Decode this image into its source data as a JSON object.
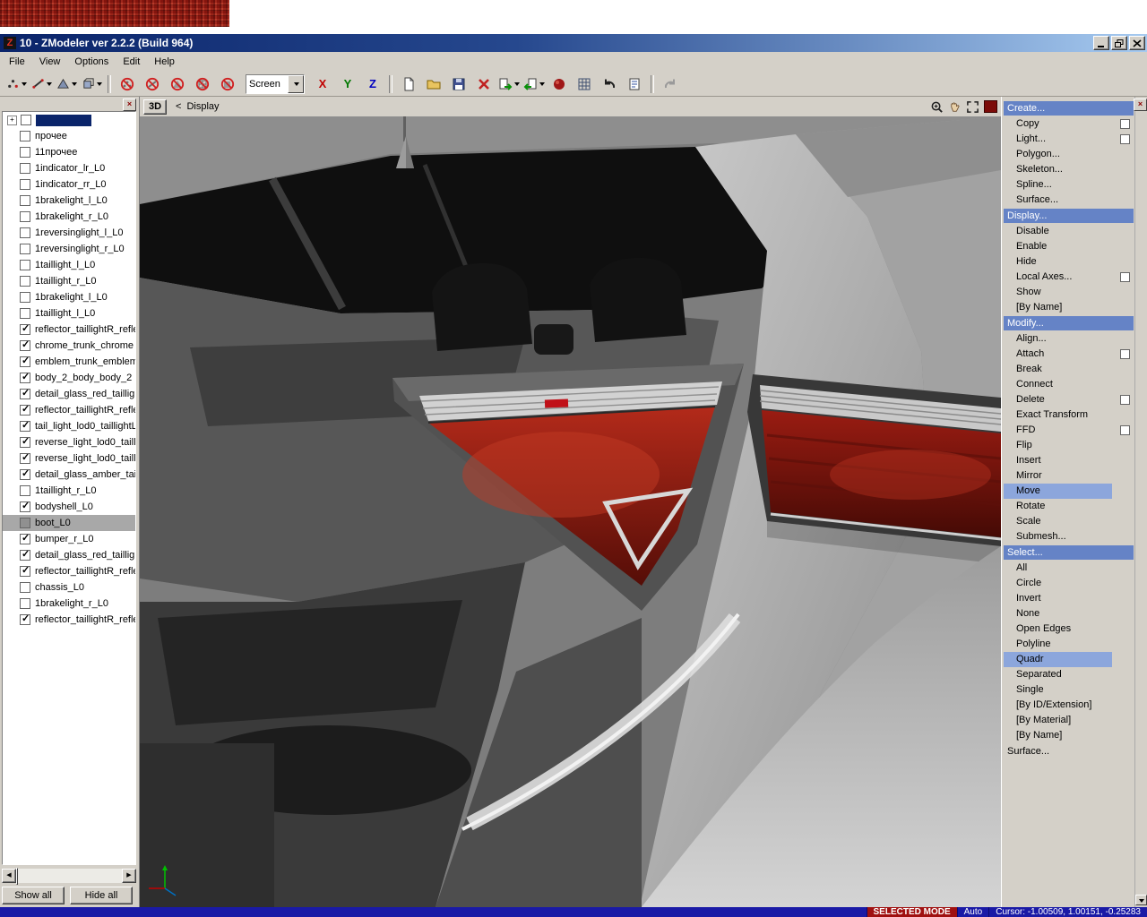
{
  "window": {
    "title": "10 - ZModeler ver 2.2.2 (Build 964)",
    "controls": [
      "minimize",
      "restore",
      "close"
    ]
  },
  "menu": {
    "items": [
      "File",
      "View",
      "Options",
      "Edit",
      "Help"
    ]
  },
  "toolbar": {
    "screen_value": "Screen",
    "axis": {
      "x": "X",
      "y": "Y",
      "z": "Z"
    },
    "mode_dropdowns": [
      "vertices-level",
      "edges-level",
      "polygons-level",
      "objects-level"
    ],
    "filter_toggles": [
      "no-vertices",
      "no-edges",
      "no-polygons",
      "no-meshes",
      "no-objects"
    ],
    "file_tools": [
      "new-file",
      "open-file",
      "save-file",
      "delete",
      "import",
      "export",
      "material-ball",
      "grid",
      "undo",
      "log",
      "redo-disabled"
    ]
  },
  "scene_tree": {
    "root": {
      "label": "",
      "expanded": false,
      "selected": true
    },
    "items": [
      {
        "label": "прочее",
        "checked": false
      },
      {
        "label": "11прочее",
        "checked": false
      },
      {
        "label": "1indicator_lr_L0",
        "checked": false
      },
      {
        "label": "1indicator_rr_L0",
        "checked": false
      },
      {
        "label": "1brakelight_l_L0",
        "checked": false
      },
      {
        "label": "1brakelight_r_L0",
        "checked": false
      },
      {
        "label": "1reversinglight_l_L0",
        "checked": false
      },
      {
        "label": "1reversinglight_r_L0",
        "checked": false
      },
      {
        "label": "1taillight_l_L0",
        "checked": false
      },
      {
        "label": "1taillight_r_L0",
        "checked": false
      },
      {
        "label": "1brakelight_l_L0",
        "checked": false
      },
      {
        "label": "1taillight_l_L0",
        "checked": false
      },
      {
        "label": "reflector_taillightR_refle",
        "checked": true
      },
      {
        "label": "chrome_trunk_chrome",
        "checked": true
      },
      {
        "label": "emblem_trunk_emblem",
        "checked": true
      },
      {
        "label": "body_2_body_body_2",
        "checked": true
      },
      {
        "label": "detail_glass_red_tailligh",
        "checked": true
      },
      {
        "label": "reflector_taillightR_refle",
        "checked": true
      },
      {
        "label": "tail_light_lod0_taillightL_",
        "checked": true
      },
      {
        "label": "reverse_light_lod0_tailli",
        "checked": true
      },
      {
        "label": "reverse_light_lod0_tailli",
        "checked": true
      },
      {
        "label": "detail_glass_amber_taill",
        "checked": true
      },
      {
        "label": "1taillight_r_L0",
        "checked": false
      },
      {
        "label": "bodyshell_L0",
        "checked": true
      },
      {
        "label": "boot_L0",
        "checked": false,
        "partial": true,
        "selected": true
      },
      {
        "label": "bumper_r_L0",
        "checked": true
      },
      {
        "label": "detail_glass_red_tailligh",
        "checked": true
      },
      {
        "label": "reflector_taillightR_refle",
        "checked": true
      },
      {
        "label": "chassis_L0",
        "checked": false
      },
      {
        "label": "1brakelight_r_L0",
        "checked": false
      },
      {
        "label": "reflector_taillightR_refle",
        "checked": true
      }
    ],
    "show_all_label": "Show all",
    "hide_all_label": "Hide all"
  },
  "viewport": {
    "tab": "3D",
    "nav_arrow": "<",
    "view_name": "Display"
  },
  "commands_panel": {
    "items": [
      {
        "label": "Create...",
        "kind": "header"
      },
      {
        "label": "Copy",
        "kind": "item",
        "checkbox": true
      },
      {
        "label": "Light...",
        "kind": "item",
        "checkbox": true
      },
      {
        "label": "Polygon...",
        "kind": "item"
      },
      {
        "label": "Skeleton...",
        "kind": "item"
      },
      {
        "label": "Spline...",
        "kind": "item"
      },
      {
        "label": "Surface...",
        "kind": "item"
      },
      {
        "label": "Display...",
        "kind": "header"
      },
      {
        "label": "Disable",
        "kind": "item"
      },
      {
        "label": "Enable",
        "kind": "item"
      },
      {
        "label": "Hide",
        "kind": "item"
      },
      {
        "label": "Local Axes...",
        "kind": "item",
        "checkbox": true
      },
      {
        "label": "Show",
        "kind": "item"
      },
      {
        "label": "[By Name]",
        "kind": "item"
      },
      {
        "label": "Modify...",
        "kind": "header"
      },
      {
        "label": "Align...",
        "kind": "item"
      },
      {
        "label": "Attach",
        "kind": "item",
        "checkbox": true
      },
      {
        "label": "Break",
        "kind": "item"
      },
      {
        "label": "Connect",
        "kind": "item"
      },
      {
        "label": "Delete",
        "kind": "item",
        "checkbox": true
      },
      {
        "label": "Exact Transform",
        "kind": "item"
      },
      {
        "label": "FFD",
        "kind": "item",
        "checkbox": true
      },
      {
        "label": "Flip",
        "kind": "item"
      },
      {
        "label": "Insert",
        "kind": "item"
      },
      {
        "label": "Mirror",
        "kind": "item"
      },
      {
        "label": "Move",
        "kind": "item",
        "selected": true
      },
      {
        "label": "Rotate",
        "kind": "item"
      },
      {
        "label": "Scale",
        "kind": "item"
      },
      {
        "label": "Submesh...",
        "kind": "item"
      },
      {
        "label": "Select...",
        "kind": "header"
      },
      {
        "label": "All",
        "kind": "item"
      },
      {
        "label": "Circle",
        "kind": "item"
      },
      {
        "label": "Invert",
        "kind": "item"
      },
      {
        "label": "None",
        "kind": "item"
      },
      {
        "label": "Open Edges",
        "kind": "item"
      },
      {
        "label": "Polyline",
        "kind": "item"
      },
      {
        "label": "Quadr",
        "kind": "item",
        "selected": true
      },
      {
        "label": "Separated",
        "kind": "item"
      },
      {
        "label": "Single",
        "kind": "item"
      },
      {
        "label": "[By ID/Extension]",
        "kind": "item"
      },
      {
        "label": "[By Material]",
        "kind": "item"
      },
      {
        "label": "[By Name]",
        "kind": "item"
      },
      {
        "label": "Surface...",
        "kind": "plain"
      }
    ]
  },
  "status_bar": {
    "selected_mode": "SELECTED MODE",
    "auto_label": "Auto",
    "cursor_text": "Cursor: -1.00509, 1.00151, -0.25283"
  },
  "colors": {
    "titlebar_left": "#0a246a",
    "titlebar_right": "#a6caf0",
    "face": "#d4d0c8",
    "header_blue": "#6583c6",
    "selected_blue": "#8ca6dc",
    "status_navy": "#1a1aa6",
    "selected_mode_red": "#a01010",
    "banner_red": "#9b241a"
  }
}
